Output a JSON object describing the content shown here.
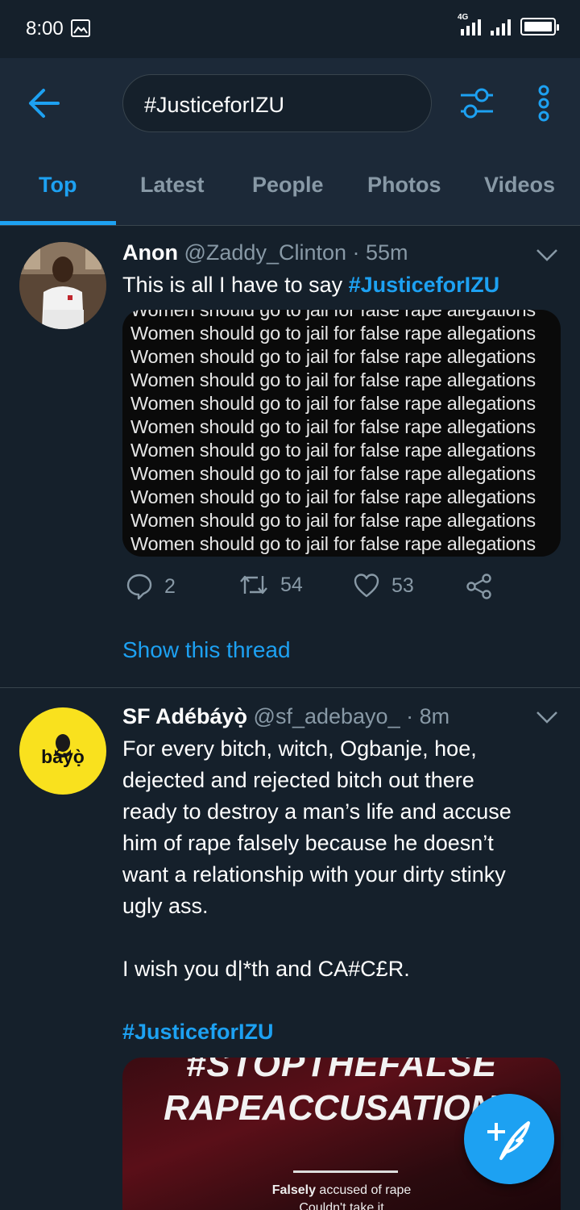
{
  "status_bar": {
    "time": "8:00",
    "network": "4G"
  },
  "search": {
    "query": "#JusticeforIZU"
  },
  "tabs": [
    {
      "label": "Top"
    },
    {
      "label": "Latest"
    },
    {
      "label": "People"
    },
    {
      "label": "Photos"
    },
    {
      "label": "Videos"
    }
  ],
  "tweets": [
    {
      "name": "Anon",
      "handle": "@Zaddy_Clinton",
      "time": "· 55m",
      "text": "This is all I have to say ",
      "hashtag": "#JusticeforIZU",
      "media_line": "Women should go to jail for false rape allegations",
      "replies": "2",
      "retweets": "54",
      "likes": "53",
      "show_thread": "Show this thread"
    },
    {
      "name": "SF Adébáyọ̀",
      "handle": "@sf_adebayo_",
      "time": "· 8m",
      "avatar_text": "báyọ̀",
      "text_lines": [
        "For every bitch, witch, Ogbanje, hoe,",
        "dejected and rejected bitch out there",
        "ready to destroy a man’s life and accuse",
        "him of rape falsely because he doesn’t",
        "want a relationship with your dirty stinky",
        "ugly ass.",
        "",
        "I wish you d|*th and CA#C£R.",
        ""
      ],
      "hashtag": "#JusticeforIZU",
      "poster": {
        "line1": "#STOPTHEFALSE",
        "line2": "RAPEACCUSATIONS",
        "sub_bold": "Falsely",
        "sub_rest": " accused of rape",
        "sub2": "Couldn't take it"
      }
    }
  ],
  "colors": {
    "accent": "#1da1f2",
    "background": "#15202b",
    "header": "#1c2938",
    "muted": "#8899a6"
  }
}
